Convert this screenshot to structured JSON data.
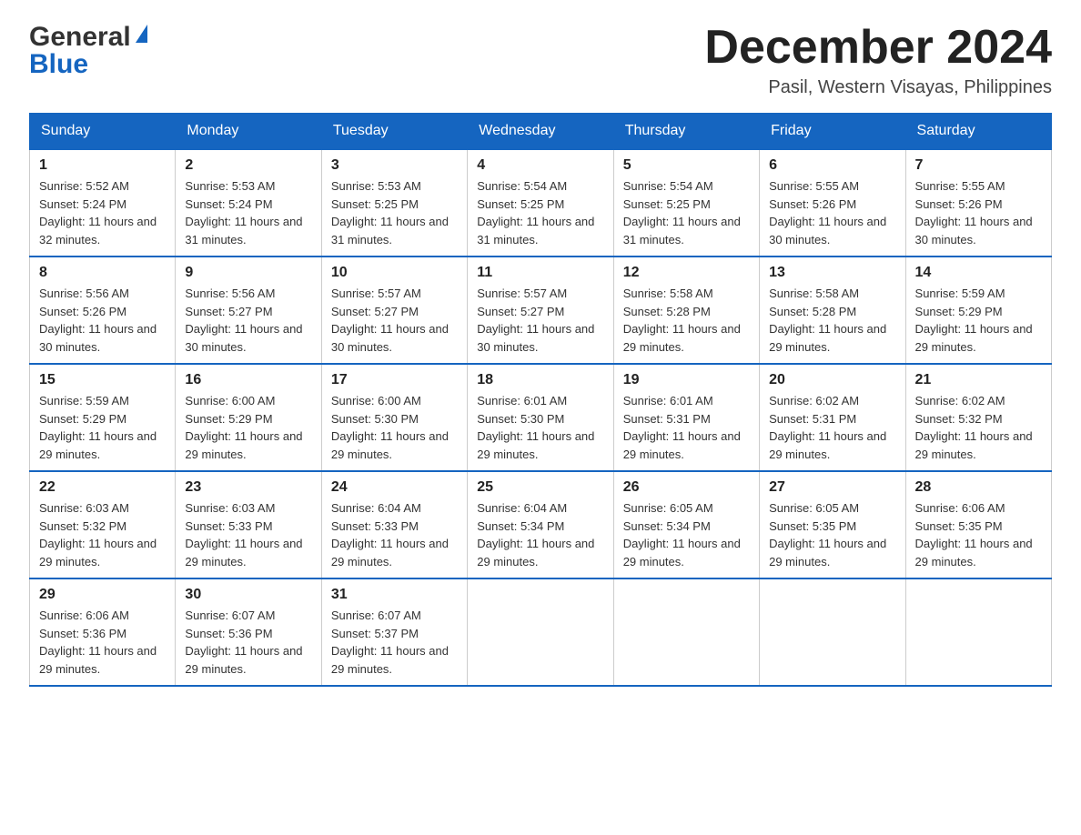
{
  "header": {
    "logo": {
      "general": "General",
      "blue": "Blue"
    },
    "title": "December 2024",
    "location": "Pasil, Western Visayas, Philippines"
  },
  "calendar": {
    "days_of_week": [
      "Sunday",
      "Monday",
      "Tuesday",
      "Wednesday",
      "Thursday",
      "Friday",
      "Saturday"
    ],
    "weeks": [
      [
        {
          "day": "1",
          "sunrise": "5:52 AM",
          "sunset": "5:24 PM",
          "daylight": "11 hours and 32 minutes."
        },
        {
          "day": "2",
          "sunrise": "5:53 AM",
          "sunset": "5:24 PM",
          "daylight": "11 hours and 31 minutes."
        },
        {
          "day": "3",
          "sunrise": "5:53 AM",
          "sunset": "5:25 PM",
          "daylight": "11 hours and 31 minutes."
        },
        {
          "day": "4",
          "sunrise": "5:54 AM",
          "sunset": "5:25 PM",
          "daylight": "11 hours and 31 minutes."
        },
        {
          "day": "5",
          "sunrise": "5:54 AM",
          "sunset": "5:25 PM",
          "daylight": "11 hours and 31 minutes."
        },
        {
          "day": "6",
          "sunrise": "5:55 AM",
          "sunset": "5:26 PM",
          "daylight": "11 hours and 30 minutes."
        },
        {
          "day": "7",
          "sunrise": "5:55 AM",
          "sunset": "5:26 PM",
          "daylight": "11 hours and 30 minutes."
        }
      ],
      [
        {
          "day": "8",
          "sunrise": "5:56 AM",
          "sunset": "5:26 PM",
          "daylight": "11 hours and 30 minutes."
        },
        {
          "day": "9",
          "sunrise": "5:56 AM",
          "sunset": "5:27 PM",
          "daylight": "11 hours and 30 minutes."
        },
        {
          "day": "10",
          "sunrise": "5:57 AM",
          "sunset": "5:27 PM",
          "daylight": "11 hours and 30 minutes."
        },
        {
          "day": "11",
          "sunrise": "5:57 AM",
          "sunset": "5:27 PM",
          "daylight": "11 hours and 30 minutes."
        },
        {
          "day": "12",
          "sunrise": "5:58 AM",
          "sunset": "5:28 PM",
          "daylight": "11 hours and 29 minutes."
        },
        {
          "day": "13",
          "sunrise": "5:58 AM",
          "sunset": "5:28 PM",
          "daylight": "11 hours and 29 minutes."
        },
        {
          "day": "14",
          "sunrise": "5:59 AM",
          "sunset": "5:29 PM",
          "daylight": "11 hours and 29 minutes."
        }
      ],
      [
        {
          "day": "15",
          "sunrise": "5:59 AM",
          "sunset": "5:29 PM",
          "daylight": "11 hours and 29 minutes."
        },
        {
          "day": "16",
          "sunrise": "6:00 AM",
          "sunset": "5:29 PM",
          "daylight": "11 hours and 29 minutes."
        },
        {
          "day": "17",
          "sunrise": "6:00 AM",
          "sunset": "5:30 PM",
          "daylight": "11 hours and 29 minutes."
        },
        {
          "day": "18",
          "sunrise": "6:01 AM",
          "sunset": "5:30 PM",
          "daylight": "11 hours and 29 minutes."
        },
        {
          "day": "19",
          "sunrise": "6:01 AM",
          "sunset": "5:31 PM",
          "daylight": "11 hours and 29 minutes."
        },
        {
          "day": "20",
          "sunrise": "6:02 AM",
          "sunset": "5:31 PM",
          "daylight": "11 hours and 29 minutes."
        },
        {
          "day": "21",
          "sunrise": "6:02 AM",
          "sunset": "5:32 PM",
          "daylight": "11 hours and 29 minutes."
        }
      ],
      [
        {
          "day": "22",
          "sunrise": "6:03 AM",
          "sunset": "5:32 PM",
          "daylight": "11 hours and 29 minutes."
        },
        {
          "day": "23",
          "sunrise": "6:03 AM",
          "sunset": "5:33 PM",
          "daylight": "11 hours and 29 minutes."
        },
        {
          "day": "24",
          "sunrise": "6:04 AM",
          "sunset": "5:33 PM",
          "daylight": "11 hours and 29 minutes."
        },
        {
          "day": "25",
          "sunrise": "6:04 AM",
          "sunset": "5:34 PM",
          "daylight": "11 hours and 29 minutes."
        },
        {
          "day": "26",
          "sunrise": "6:05 AM",
          "sunset": "5:34 PM",
          "daylight": "11 hours and 29 minutes."
        },
        {
          "day": "27",
          "sunrise": "6:05 AM",
          "sunset": "5:35 PM",
          "daylight": "11 hours and 29 minutes."
        },
        {
          "day": "28",
          "sunrise": "6:06 AM",
          "sunset": "5:35 PM",
          "daylight": "11 hours and 29 minutes."
        }
      ],
      [
        {
          "day": "29",
          "sunrise": "6:06 AM",
          "sunset": "5:36 PM",
          "daylight": "11 hours and 29 minutes."
        },
        {
          "day": "30",
          "sunrise": "6:07 AM",
          "sunset": "5:36 PM",
          "daylight": "11 hours and 29 minutes."
        },
        {
          "day": "31",
          "sunrise": "6:07 AM",
          "sunset": "5:37 PM",
          "daylight": "11 hours and 29 minutes."
        },
        null,
        null,
        null,
        null
      ]
    ]
  }
}
